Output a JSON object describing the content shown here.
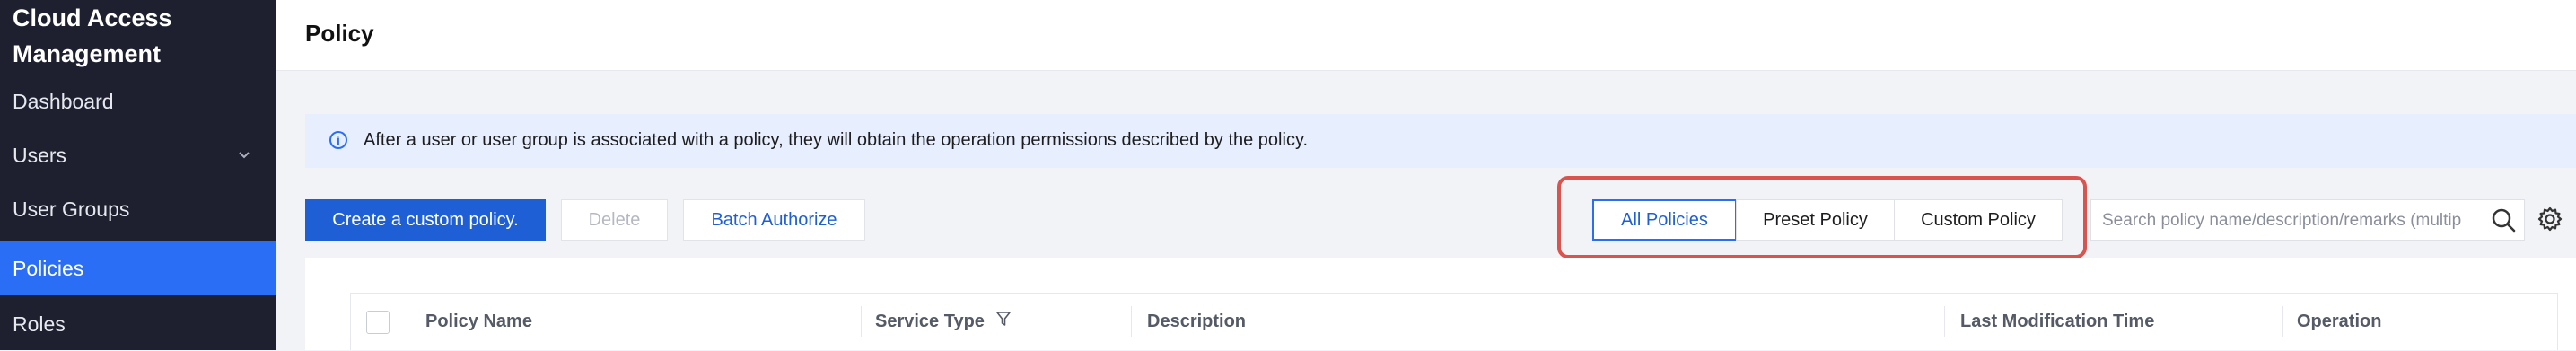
{
  "sidebar": {
    "brand": "Cloud Access Management",
    "items": [
      {
        "label": "Dashboard"
      },
      {
        "label": "Users"
      },
      {
        "label": "User Groups"
      },
      {
        "label": "Policies"
      },
      {
        "label": "Roles"
      }
    ]
  },
  "header": {
    "title": "Policy"
  },
  "info": {
    "text": "After a user or user group is associated with a policy, they will obtain the operation permissions described by the policy."
  },
  "toolbar": {
    "create_label": "Create a custom policy.",
    "delete_label": "Delete",
    "batch_label": "Batch Authorize"
  },
  "filter": {
    "tabs": [
      {
        "label": "All Policies",
        "active": true
      },
      {
        "label": "Preset Policy",
        "active": false
      },
      {
        "label": "Custom Policy",
        "active": false
      }
    ],
    "highlight_color": "#d9534f"
  },
  "search": {
    "placeholder": "Search policy name/description/remarks (multiple keywords separated by |)"
  },
  "table": {
    "columns": [
      "Policy Name",
      "Service Type",
      "Description",
      "Last Modification Time",
      "Operation"
    ]
  },
  "colors": {
    "accent": "#2a6ef5",
    "sidebar_bg": "#1e2030",
    "primary_button": "#1f5fd6"
  }
}
